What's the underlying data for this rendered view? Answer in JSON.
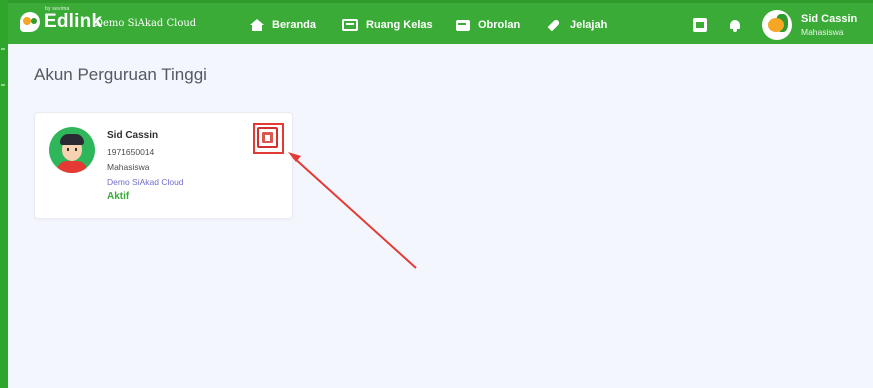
{
  "app": {
    "logo_text": "Edlink",
    "logo_tagline": "by sevima",
    "institution": "Demo SiAkad Cloud"
  },
  "nav": {
    "items": [
      {
        "label": "Beranda",
        "icon": "home-icon"
      },
      {
        "label": "Ruang Kelas",
        "icon": "classroom-icon"
      },
      {
        "label": "Obrolan",
        "icon": "chat-icon"
      },
      {
        "label": "Jelajah",
        "icon": "rocket-icon"
      }
    ]
  },
  "user": {
    "name": "Sid Cassin",
    "role": "Mahasiswa"
  },
  "main": {
    "title": "Akun Perguruan Tinggi",
    "card": {
      "name": "Sid Cassin",
      "nim": "1971650014",
      "role": "Mahasiswa",
      "institution": "Demo SiAkad Cloud",
      "status": "Aktif"
    }
  },
  "colors": {
    "brand_green": "#3aab36",
    "annotation_red": "#e53935",
    "institution_link": "#6f6fd0"
  }
}
